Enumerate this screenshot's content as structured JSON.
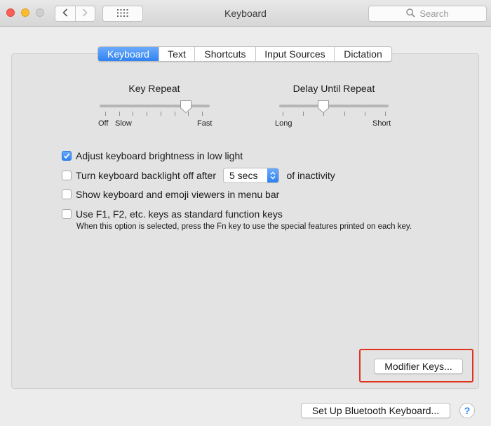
{
  "window": {
    "title": "Keyboard"
  },
  "search": {
    "placeholder": "Search"
  },
  "tabs": [
    {
      "label": "Keyboard",
      "active": true
    },
    {
      "label": "Text",
      "active": false
    },
    {
      "label": "Shortcuts",
      "active": false
    },
    {
      "label": "Input Sources",
      "active": false
    },
    {
      "label": "Dictation",
      "active": false
    }
  ],
  "key_repeat": {
    "title": "Key Repeat",
    "labels": {
      "off": "Off",
      "slow": "Slow",
      "fast": "Fast"
    },
    "value_fraction": 0.83
  },
  "delay_until_repeat": {
    "title": "Delay Until Repeat",
    "labels": {
      "long": "Long",
      "short": "Short"
    },
    "value_fraction": 0.4
  },
  "options": {
    "brightness": {
      "label": "Adjust keyboard brightness in low light",
      "checked": true
    },
    "backlight": {
      "label_before": "Turn keyboard backlight off after",
      "value": "5 secs",
      "label_after": "of inactivity",
      "checked": false
    },
    "viewers": {
      "label": "Show keyboard and emoji viewers in menu bar",
      "checked": false
    },
    "fkeys": {
      "label": "Use F1, F2, etc. keys as standard function keys",
      "checked": false,
      "note": "When this option is selected, press the Fn key to use the special features printed on each key."
    }
  },
  "buttons": {
    "modifier_keys": "Modifier Keys...",
    "bluetooth": "Set Up Bluetooth Keyboard...",
    "help": "?"
  },
  "colors": {
    "accent": "#2e82f2",
    "highlight_box": "#e1341e"
  }
}
